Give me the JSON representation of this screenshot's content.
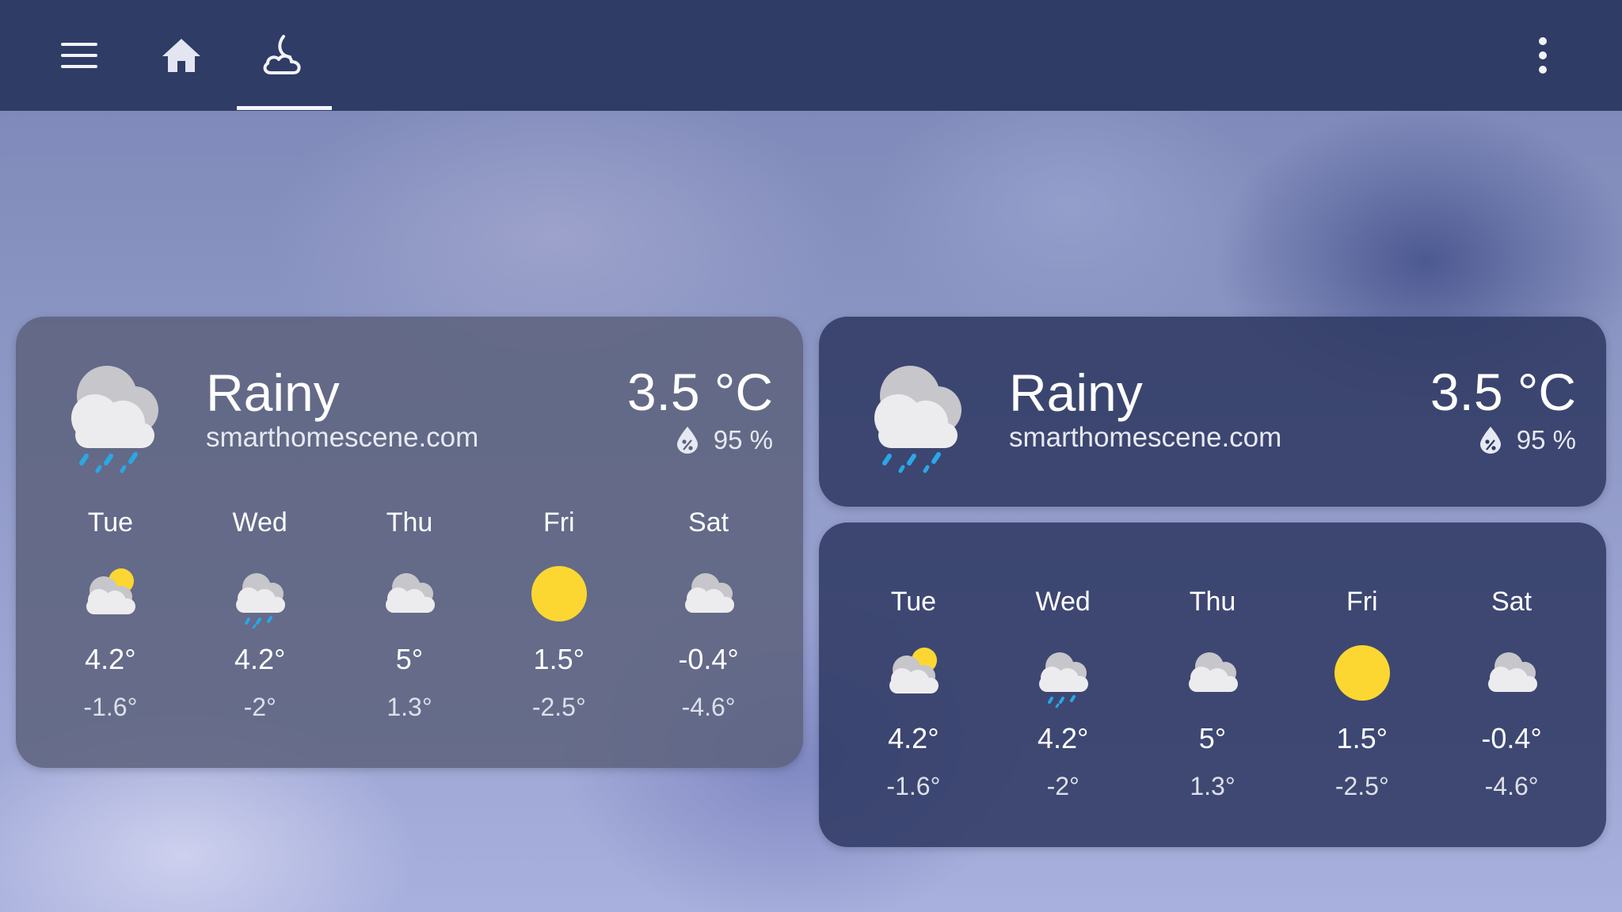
{
  "toolbar": {
    "icons": [
      "menu-icon",
      "home-icon",
      "weather-night-partly-cloudy-icon",
      "more-vertical-icon"
    ],
    "active_tab": "weather",
    "bar_color": "#2e3c66"
  },
  "weather_cards": [
    {
      "condition": "Rainy",
      "source": "smarthomescene.com",
      "temperature": "3.5 °C",
      "humidity": "95 %",
      "current_icon": "rainy-cloud-icon"
    },
    {
      "condition": "Rainy",
      "source": "smarthomescene.com",
      "temperature": "3.5 °C",
      "humidity": "95 %",
      "current_icon": "rainy-cloud-icon"
    }
  ],
  "forecast": [
    {
      "day": "Tue",
      "high": "4.2°",
      "low": "-1.6°",
      "icon": "partly-cloudy-icon"
    },
    {
      "day": "Wed",
      "high": "4.2°",
      "low": "-2°",
      "icon": "rain-cloud-icon"
    },
    {
      "day": "Thu",
      "high": "5°",
      "low": "1.3°",
      "icon": "cloudy-icon"
    },
    {
      "day": "Fri",
      "high": "1.5°",
      "low": "-2.5°",
      "icon": "sunny-icon"
    },
    {
      "day": "Sat",
      "high": "-0.4°",
      "low": "-4.6°",
      "icon": "cloudy-icon"
    }
  ],
  "colors": {
    "sun": "#fcd731",
    "cloud": "#e9e9ec",
    "rain": "#2aa7e6",
    "card_left": "#5c627d",
    "card_right": "#303a64"
  }
}
